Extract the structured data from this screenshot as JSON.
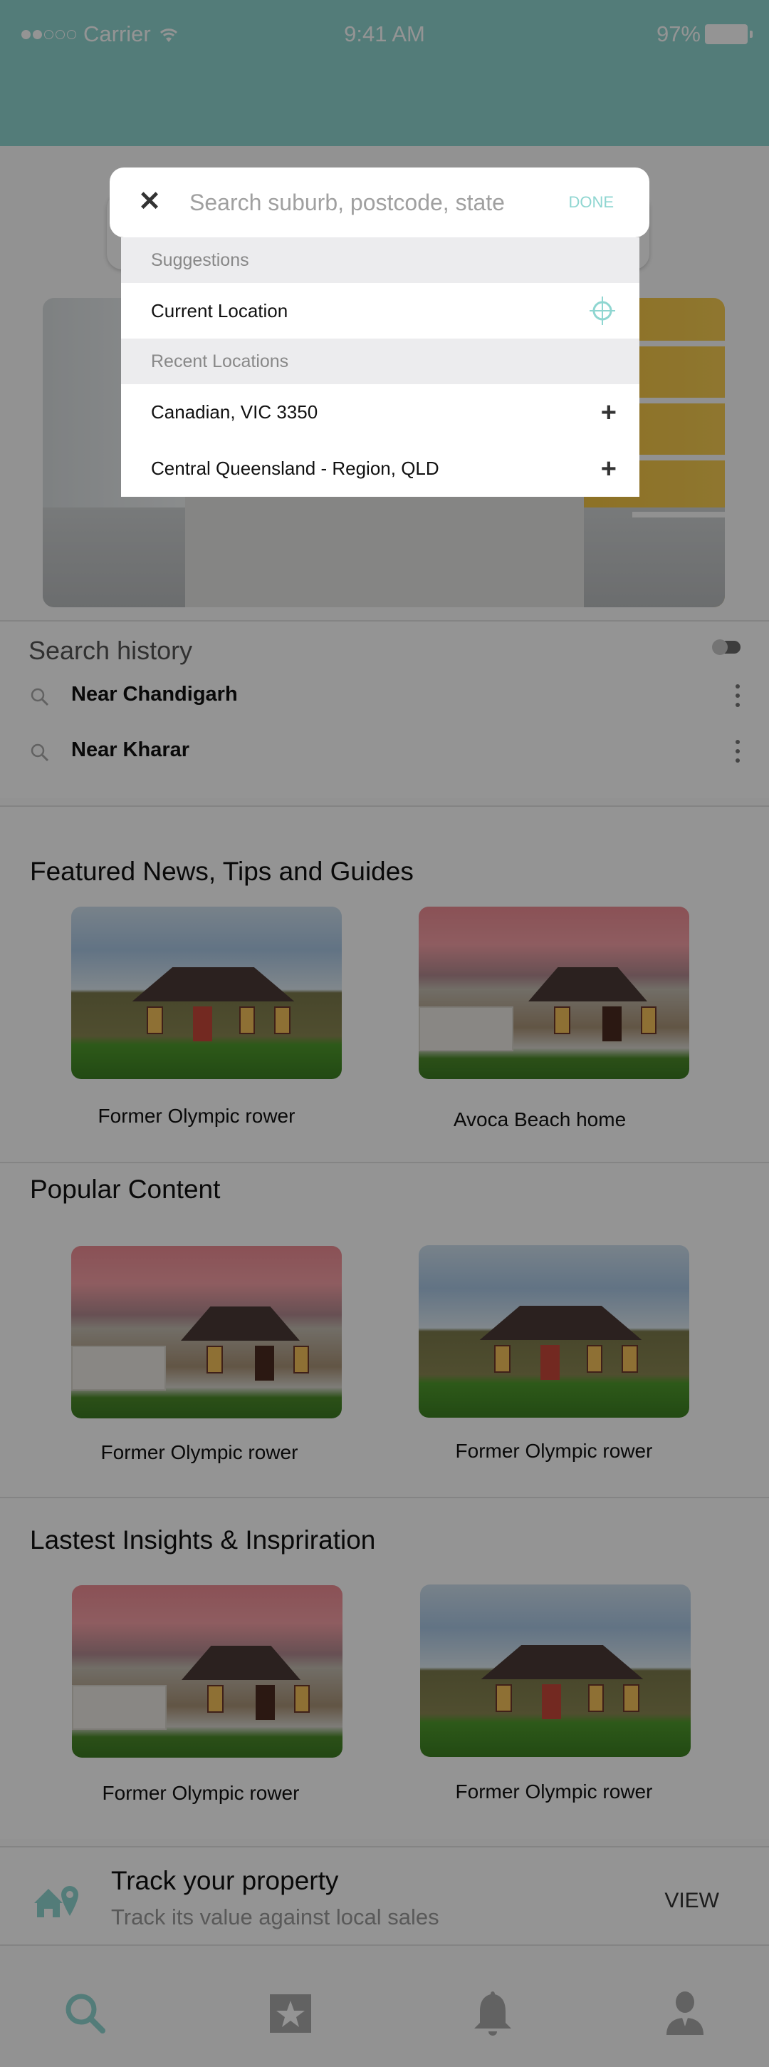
{
  "status_bar": {
    "signal_dots_filled": 2,
    "signal_dots_total": 5,
    "carrier": "Carrier",
    "time": "9:41 AM",
    "battery": "97%"
  },
  "colors": {
    "accent": "#8fd6d1",
    "header": "#8fd6d1",
    "overlay": "rgba(0,0,0,0.42)"
  },
  "search_popup": {
    "close_icon": "close-icon",
    "placeholder": "Search suburb, postcode, state",
    "value": "",
    "done_label": "DONE",
    "suggestions_header": "Suggestions",
    "current_location_label": "Current Location",
    "current_location_icon": "crosshair-icon",
    "recent_header": "Recent Locations",
    "recent_locations": [
      {
        "label": "Canadian, VIC 3350",
        "action_icon": "plus-icon"
      },
      {
        "label": "Central Queensland - Region, QLD",
        "action_icon": "plus-icon"
      }
    ]
  },
  "search_history": {
    "title": "Search history",
    "toggle_on": false,
    "items": [
      {
        "label": "Near Chandigarh"
      },
      {
        "label": "Near Kharar"
      }
    ]
  },
  "sections": [
    {
      "title": "Featured News, Tips and Guides",
      "cards": [
        {
          "caption": "Former Olympic rower",
          "image": "house-blue-sky"
        },
        {
          "caption": "Avoca Beach home",
          "image": "house-pink-sky"
        }
      ]
    },
    {
      "title": "Popular Content",
      "cards": [
        {
          "caption": "Former Olympic rower",
          "image": "house-pink-sky"
        },
        {
          "caption": "Former Olympic rower",
          "image": "house-blue-sky"
        }
      ]
    },
    {
      "title": "Lastest Insights & Inspriration",
      "cards": [
        {
          "caption": "Former Olympic rower",
          "image": "house-pink-sky"
        },
        {
          "caption": "Former Olympic rower",
          "image": "house-blue-sky"
        }
      ]
    }
  ],
  "track_property": {
    "icon": "home-pin-icon",
    "title": "Track your property",
    "subtitle": "Track its value against local sales",
    "action_label": "VIEW"
  },
  "tab_bar": {
    "tabs": [
      {
        "name": "search",
        "icon": "search-icon",
        "active": true
      },
      {
        "name": "saved",
        "icon": "star-bookmark-icon",
        "active": false
      },
      {
        "name": "notifications",
        "icon": "bell-icon",
        "active": false
      },
      {
        "name": "profile",
        "icon": "user-icon",
        "active": false
      }
    ]
  }
}
